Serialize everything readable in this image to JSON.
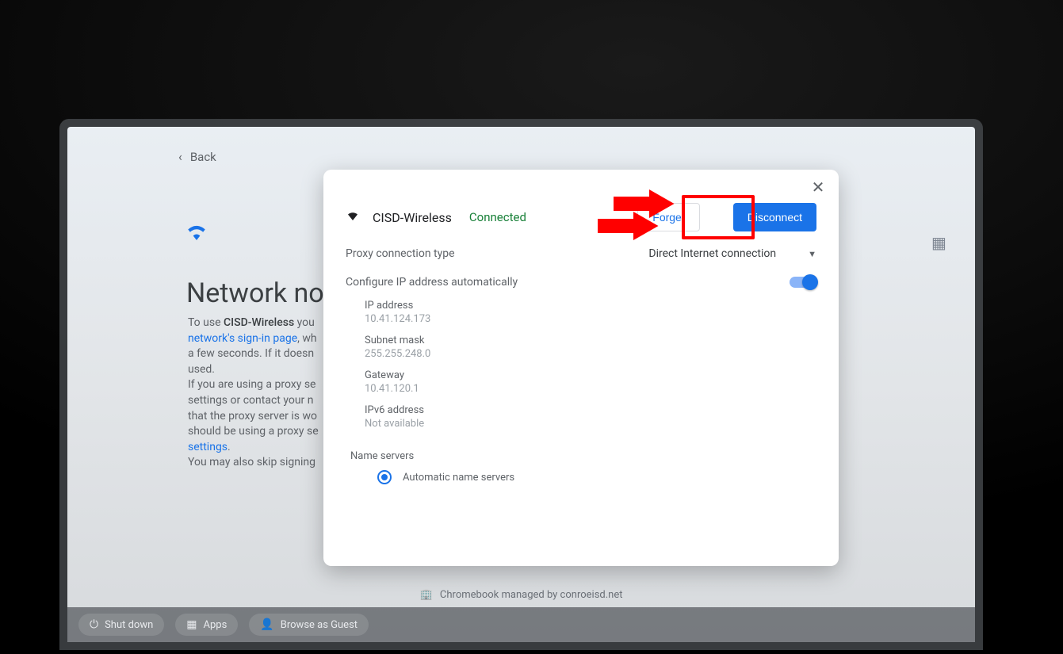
{
  "back": {
    "label": "Back"
  },
  "page": {
    "title": "Network not",
    "ssid_bold": "CISD-Wireless",
    "line_pre": "To use ",
    "line_post": " you",
    "signin_link": "network's sign-in page",
    "line2_post": ", wh",
    "line3": "a few seconds. If it doesn",
    "line4": "used.",
    "line5": "If you are using a proxy se",
    "line6": "settings or contact your n",
    "line7": "that the proxy server is wo",
    "line8": "should be using a proxy se",
    "settings_link": "settings",
    "line9_post": ".",
    "line10": "You may also skip signing"
  },
  "dialog": {
    "ssid": "CISD-Wireless",
    "status": "Connected",
    "forget": "Forget",
    "disconnect": "Disconnect",
    "proxy_label": "Proxy connection type",
    "proxy_value": "Direct Internet connection",
    "auto_ip_label": "Configure IP address automatically",
    "ip": {
      "ip_label": "IP address",
      "ip_val": "10.41.124.173",
      "sn_label": "Subnet mask",
      "sn_val": "255.255.248.0",
      "gw_label": "Gateway",
      "gw_val": "10.41.120.1",
      "v6_label": "IPv6 address",
      "v6_val": "Not available"
    },
    "name_servers_label": "Name servers",
    "ns_radio": "Automatic name servers"
  },
  "managed": {
    "text": "Chromebook managed by conroeisd.net"
  },
  "taskbar": {
    "shutdown": "Shut down",
    "apps": "Apps",
    "guest": "Browse as Guest"
  }
}
